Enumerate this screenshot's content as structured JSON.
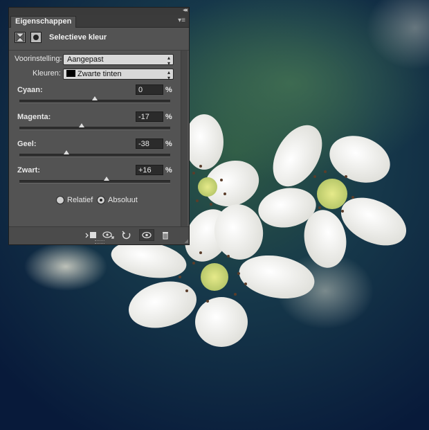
{
  "panel": {
    "tab_label": "Eigenschappen",
    "collapse_icon": "double-chevron-right-icon",
    "menu_icon": "panel-menu-icon",
    "adjustment_title": "Selectieve kleur",
    "preset_label": "Voorinstelling:",
    "preset_value": "Aangepast",
    "colors_label": "Kleuren:",
    "colors_value": "Zwarte tinten",
    "sliders": [
      {
        "label": "Cyaan:",
        "value": "0",
        "amount": 0
      },
      {
        "label": "Magenta:",
        "value": "-17",
        "amount": -17
      },
      {
        "label": "Geel:",
        "value": "-38",
        "amount": -38
      },
      {
        "label": "Zwart:",
        "value": "+16",
        "amount": 16
      }
    ],
    "percent_sign": "%",
    "method": {
      "relative_label": "Relatief",
      "absolute_label": "Absoluut",
      "selected": "Absoluut"
    },
    "footer_icons": [
      "clip-to-layer-icon",
      "view-previous-state-icon",
      "reset-icon",
      "visibility-eye-icon",
      "trash-icon"
    ]
  },
  "colors": {
    "panel_bg": "#535353",
    "dark_bar": "#3b3b3b",
    "photo_bg_dark": "#0a1f3c",
    "photo_bg_green": "#1f4a3e",
    "petal": "#f4f4f2",
    "stamen": "#d9e07a"
  }
}
